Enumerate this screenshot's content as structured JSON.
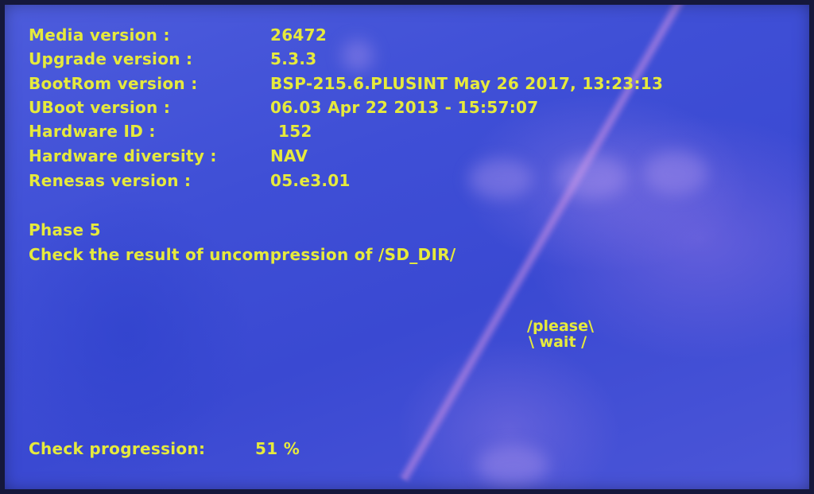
{
  "info": [
    {
      "label": "Media version :",
      "value": "26472"
    },
    {
      "label": "Upgrade version :",
      "value": "5.3.3"
    },
    {
      "label": "BootRom version :",
      "value": "BSP-215.6.PLUSINT May 26 2017, 13:23:13"
    },
    {
      "label": "UBoot version :",
      "value": "06.03 Apr 22 2013 - 15:57:07"
    },
    {
      "label": "Hardware ID :",
      "value": "152"
    },
    {
      "label": "Hardware diversity :",
      "value": "NAV"
    },
    {
      "label": "Renesas version :",
      "value": "05.e3.01"
    }
  ],
  "phase": {
    "title": "Phase 5",
    "message": "Check the result of uncompression of /SD_DIR/"
  },
  "wait": {
    "line1": "/please\\",
    "line2": "\\ wait  /"
  },
  "progress": {
    "label": "Check progression:",
    "value": "51 %"
  },
  "colors": {
    "text": "#e6ea3c",
    "background": "#3f4fd6"
  }
}
